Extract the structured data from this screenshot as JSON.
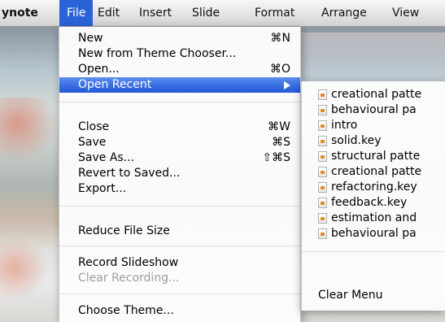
{
  "menubar": {
    "app": "ynote",
    "items": [
      "File",
      "Edit",
      "Insert",
      "Slide",
      "Format",
      "Arrange",
      "View"
    ]
  },
  "file_menu": {
    "items": [
      {
        "label": "New",
        "shortcut": "⌘N"
      },
      {
        "label": "New from Theme Chooser...",
        "shortcut": ""
      },
      {
        "label": "Open...",
        "shortcut": "⌘O"
      },
      {
        "label": "Open Recent",
        "shortcut": ""
      },
      {
        "label": "Close",
        "shortcut": "⌘W"
      },
      {
        "label": "Save",
        "shortcut": "⌘S"
      },
      {
        "label": "Save As...",
        "shortcut": "⇧⌘S"
      },
      {
        "label": "Revert to Saved...",
        "shortcut": ""
      },
      {
        "label": "Export...",
        "shortcut": ""
      },
      {
        "label": "Reduce File Size",
        "shortcut": ""
      },
      {
        "label": "Record Slideshow",
        "shortcut": ""
      },
      {
        "label": "Clear Recording...",
        "shortcut": ""
      },
      {
        "label": "Choose Theme...",
        "shortcut": ""
      }
    ]
  },
  "recent_menu": {
    "items": [
      "creational patte",
      "behavioural pa",
      "intro",
      "solid.key",
      "structural patte",
      "creational patte",
      "refactoring.key",
      "feedback.key",
      "estimation and",
      "behavioural pa"
    ],
    "clear_label": "Clear Menu"
  },
  "colors": {
    "highlight": "#2a62d8",
    "disabled_text": "#9c9c9c"
  }
}
